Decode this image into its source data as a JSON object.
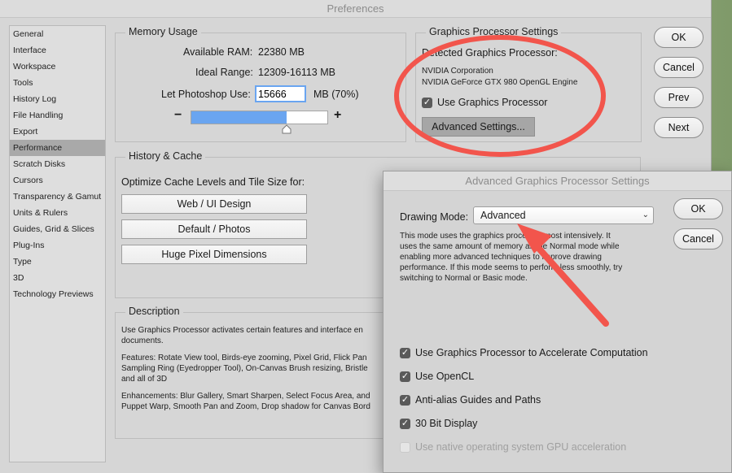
{
  "window": {
    "title": "Preferences"
  },
  "sidebar": {
    "items": [
      {
        "label": "General"
      },
      {
        "label": "Interface"
      },
      {
        "label": "Workspace"
      },
      {
        "label": "Tools"
      },
      {
        "label": "History Log"
      },
      {
        "label": "File Handling"
      },
      {
        "label": "Export"
      },
      {
        "label": "Performance",
        "selected": true
      },
      {
        "label": "Scratch Disks"
      },
      {
        "label": "Cursors"
      },
      {
        "label": "Transparency & Gamut"
      },
      {
        "label": "Units & Rulers"
      },
      {
        "label": "Guides, Grid & Slices"
      },
      {
        "label": "Plug-Ins"
      },
      {
        "label": "Type"
      },
      {
        "label": "3D"
      },
      {
        "label": "Technology Previews"
      }
    ]
  },
  "memory": {
    "title": "Memory Usage",
    "available_label": "Available RAM:",
    "available_value": "22380 MB",
    "ideal_label": "Ideal Range:",
    "ideal_value": "12309-16113 MB",
    "let_label": "Let Photoshop Use:",
    "let_value": "15666",
    "let_unit": "MB (70%)",
    "minus": "−",
    "plus": "+",
    "slider_fraction": 0.7
  },
  "gpu": {
    "title": "Graphics Processor Settings",
    "detected_label": "Detected Graphics Processor:",
    "vendor": "NVIDIA Corporation",
    "model": "NVIDIA GeForce GTX 980 OpenGL Engine",
    "use_label": "Use Graphics Processor",
    "use_checked": true,
    "advanced_button": "Advanced Settings..."
  },
  "history": {
    "title": "History & Cache",
    "optimize_label": "Optimize Cache Levels and Tile Size for:",
    "buttons": [
      "Web / UI Design",
      "Default / Photos",
      "Huge Pixel Dimensions"
    ]
  },
  "description": {
    "title": "Description",
    "p1a": "Use Graphics Processor activates certain features and interface en",
    "p1b": "documents.",
    "p2a": "Features: Rotate View tool, Birds-eye zooming, Pixel Grid, Flick Pan",
    "p2b": "Sampling Ring (Eyedropper Tool), On-Canvas Brush resizing, Bristle",
    "p2c": "and all of 3D",
    "p3a": "Enhancements: Blur Gallery, Smart Sharpen, Select Focus Area, and",
    "p3b": "Puppet Warp, Smooth Pan and Zoom, Drop shadow for Canvas Bord"
  },
  "buttons": {
    "ok": "OK",
    "cancel": "Cancel",
    "prev": "Prev",
    "next": "Next"
  },
  "advanced": {
    "title": "Advanced Graphics Processor Settings",
    "drawing_mode_label": "Drawing Mode:",
    "drawing_mode_value": "Advanced",
    "desc1": "This mode uses the graphics processor most intensively.  It",
    "desc2": "uses the same amount of memory as the Normal mode while",
    "desc3": "enabling more advanced techniques to improve drawing",
    "desc4": "performance.  If this mode seems to perform less smoothly, try",
    "desc5": "switching to Normal or Basic mode.",
    "ok": "OK",
    "cancel": "Cancel",
    "options": [
      {
        "label": "Use Graphics Processor to Accelerate Computation",
        "checked": true,
        "enabled": true
      },
      {
        "label": "Use OpenCL",
        "checked": true,
        "enabled": true
      },
      {
        "label": "Anti-alias Guides and Paths",
        "checked": true,
        "enabled": true
      },
      {
        "label": "30 Bit Display",
        "checked": true,
        "enabled": true
      },
      {
        "label": "Use native operating system GPU acceleration",
        "checked": false,
        "enabled": false
      }
    ]
  },
  "colors": {
    "annotation": "#f2554c",
    "slider_fill": "#6aa5f0"
  }
}
